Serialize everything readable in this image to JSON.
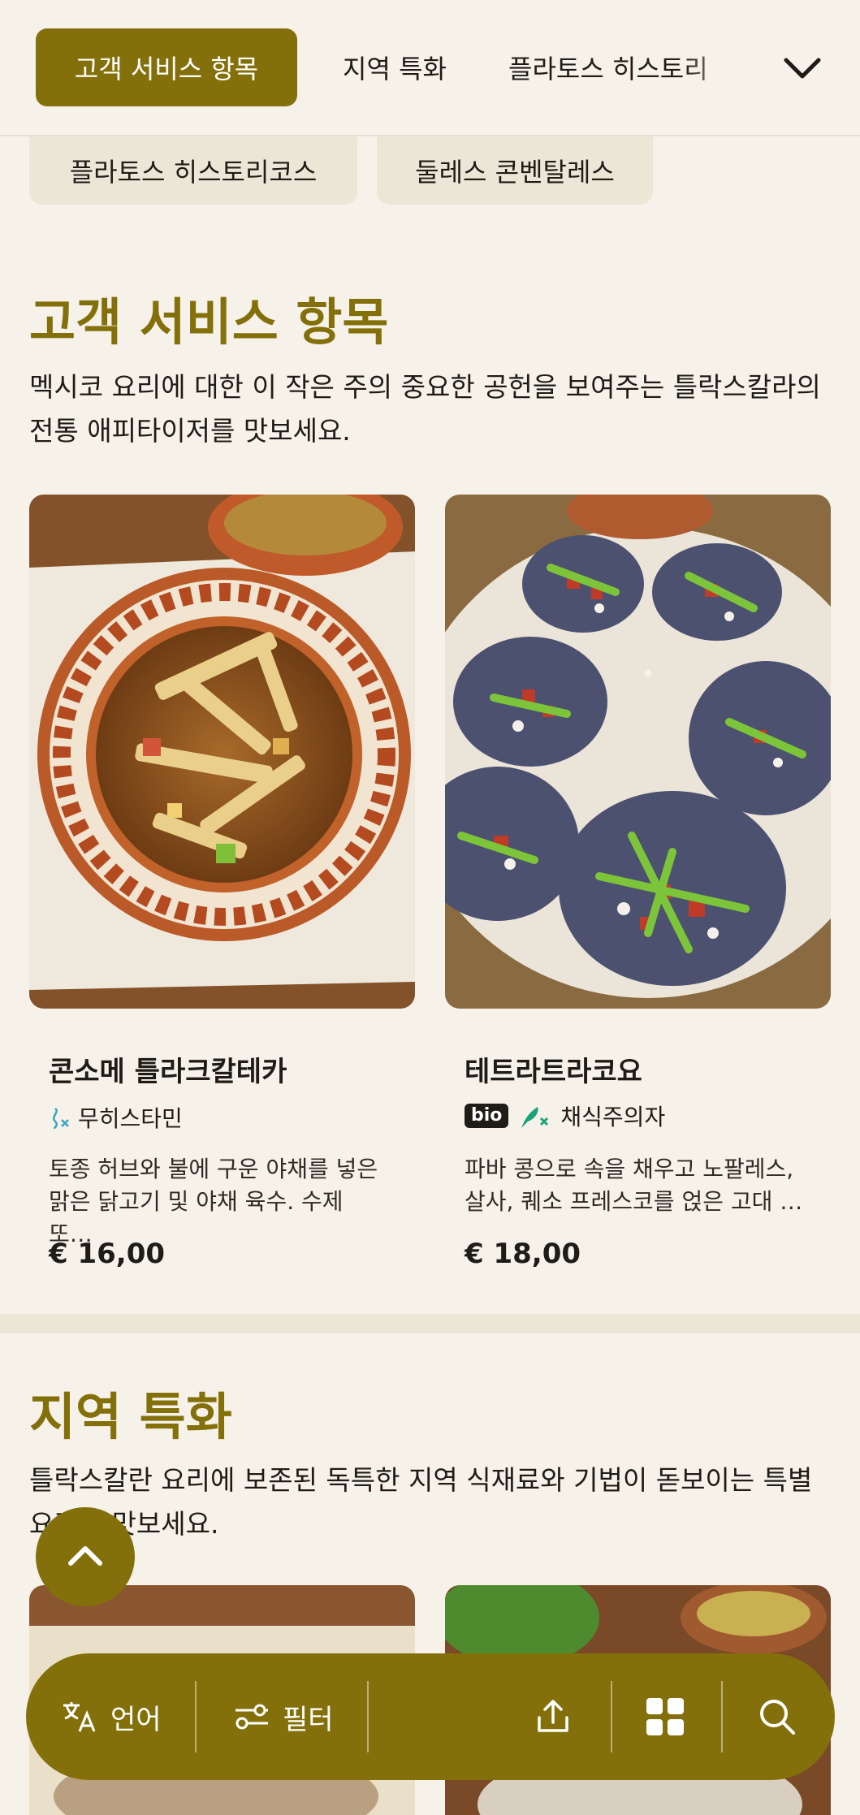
{
  "tabs": [
    {
      "label": "고객 서비스 항목",
      "active": true
    },
    {
      "label": "지역 특화",
      "active": false
    },
    {
      "label": "플라토스 히스토리",
      "active": false
    }
  ],
  "chips": [
    "플라토스 히스토리코스",
    "둘레스 콘벤탈레스"
  ],
  "section1": {
    "title": "고객 서비스 항목",
    "description": "멕시코 요리에 대한 이 작은 주의 중요한 공헌을 보여주는 틀락스칼라의 전통 애피타이저를 맛보세요.",
    "cards": [
      {
        "title": "콘소메 틀라크칼테카",
        "tag": "무히스타민",
        "description": "토종 허브와 불에 구운 야채를 넣은 맑은 닭고기 및 야채 육수. 수제 또…",
        "price": "€ 16,00"
      },
      {
        "title": "테트라트라코요",
        "bio_badge": "bio",
        "tag": "채식주의자",
        "description": "파바 콩으로 속을 채우고 노팔레스, 살사, 퀘소 프레스코를 얹은 고대 …",
        "price": "€ 18,00"
      }
    ]
  },
  "section2": {
    "title": "지역 특화",
    "description": "틀락스칼란 요리에 보존된 독특한 지역 식재료와 기법이 돋보이는 특별요리를 맛보세요."
  },
  "bottom_bar": {
    "language_label": "언어",
    "filter_label": "필터"
  },
  "colors": {
    "accent": "#84700a",
    "background": "#f6f2ea",
    "chip": "#ece6d7",
    "veg_green": "#1aa37a"
  }
}
